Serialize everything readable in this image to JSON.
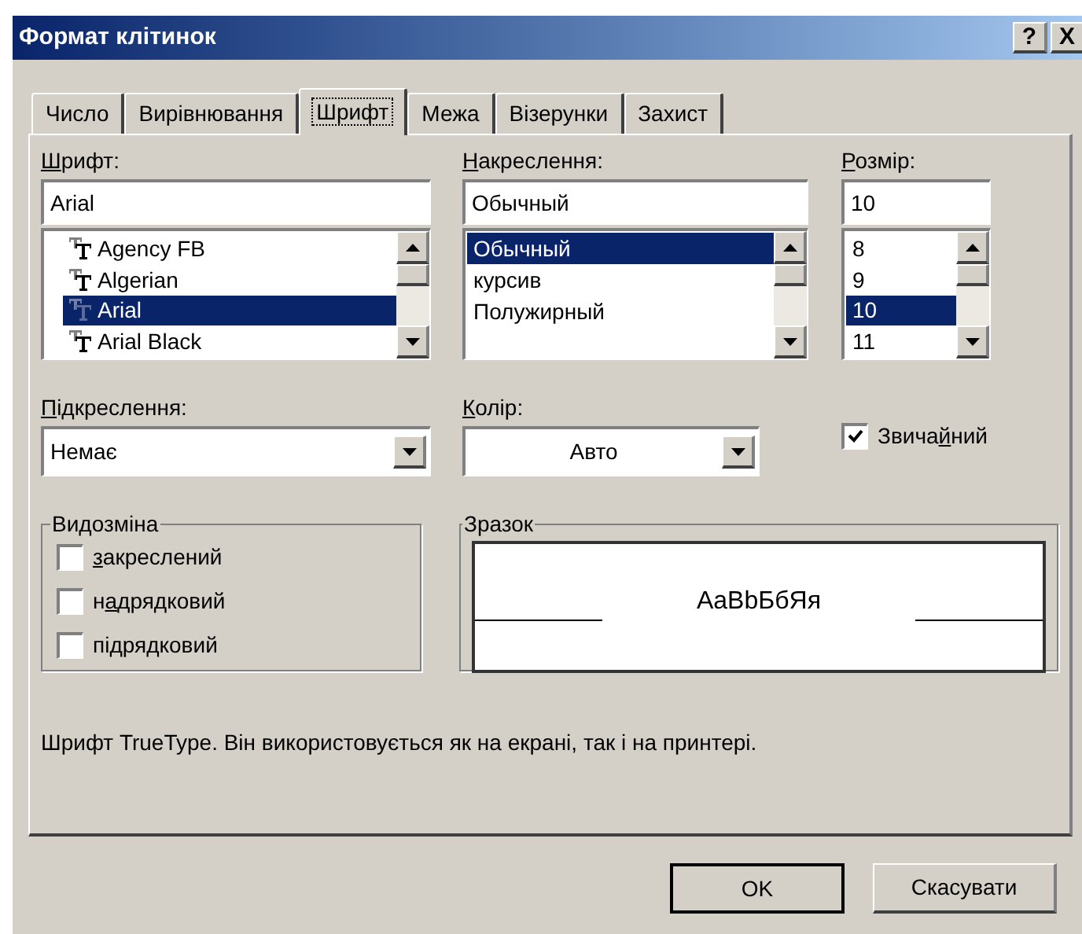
{
  "window": {
    "title": "Формат клітинок",
    "title_buttons": [
      "?",
      "X"
    ]
  },
  "tabs": [
    {
      "label": "Число",
      "selected": false
    },
    {
      "label": "Вирівнювання",
      "selected": false
    },
    {
      "label": "Шрифт",
      "selected": true
    },
    {
      "label": "Межа",
      "selected": false
    },
    {
      "label": "Візерунки",
      "selected": false
    },
    {
      "label": "Захист",
      "selected": false
    }
  ],
  "lists": [
    {
      "label_parts": {
        "key": "Ш",
        "post": "рифт:"
      },
      "value": "Arial",
      "kind": "font",
      "items": [
        {
          "text": "Agency FB",
          "selected": false
        },
        {
          "text": "Algerian",
          "selected": false
        },
        {
          "text": "Arial",
          "selected": true
        },
        {
          "text": "Arial Black",
          "selected": false
        }
      ]
    },
    {
      "label_parts": {
        "key": "Н",
        "post": "акреслення:"
      },
      "value": "Обычный",
      "kind": "plain",
      "items": [
        {
          "text": "Обычный",
          "selected": true
        },
        {
          "text": "курсив",
          "selected": false
        },
        {
          "text": "Полужирный",
          "selected": false
        }
      ]
    },
    {
      "label_parts": {
        "key": "Р",
        "post": "озмір:"
      },
      "value": "10",
      "kind": "plain",
      "items": [
        {
          "text": "8",
          "selected": false
        },
        {
          "text": "9",
          "selected": false
        },
        {
          "text": "10",
          "selected": true
        },
        {
          "text": "11",
          "selected": false
        }
      ]
    }
  ],
  "underline": {
    "label_parts": {
      "key": "П",
      "post": "ідкреслення:"
    },
    "value": "Немає"
  },
  "color": {
    "label_parts": {
      "key": "К",
      "post": "олір:"
    },
    "value": "Авто"
  },
  "normal_font": {
    "label_parts": {
      "pre": "Звича",
      "key": "й",
      "post": "ний"
    },
    "checked": true
  },
  "effects": {
    "title": "Видозміна",
    "items": [
      {
        "label_parts": {
          "key": "з",
          "post": "акреслений"
        },
        "checked": false
      },
      {
        "label_parts": {
          "pre": "н",
          "key": "а",
          "post": "дрядковий"
        },
        "checked": false
      },
      {
        "label_parts": {
          "post": "підрядковий"
        },
        "checked": false
      }
    ]
  },
  "preview": {
    "title": "Зразок",
    "sample": "AaBbБбЯя"
  },
  "description": "Шрифт TrueType. Він використовується як на екрані, так і на принтері.",
  "buttons": [
    {
      "label": "OK"
    },
    {
      "label": "Скасувати"
    }
  ]
}
